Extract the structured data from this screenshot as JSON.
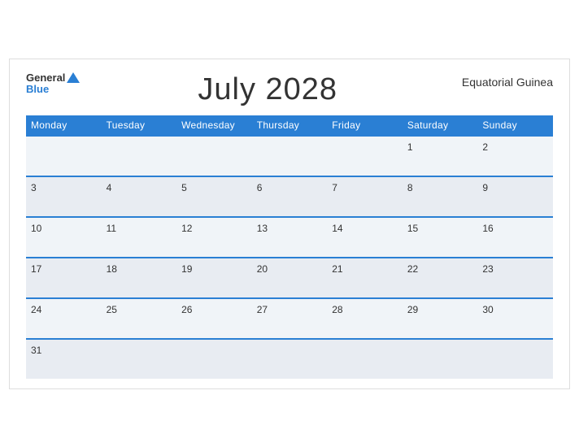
{
  "header": {
    "logo_general": "General",
    "logo_blue": "Blue",
    "month_title": "July 2028",
    "country": "Equatorial Guinea"
  },
  "days_of_week": [
    "Monday",
    "Tuesday",
    "Wednesday",
    "Thursday",
    "Friday",
    "Saturday",
    "Sunday"
  ],
  "weeks": [
    [
      null,
      null,
      null,
      null,
      null,
      1,
      2
    ],
    [
      3,
      4,
      5,
      6,
      7,
      8,
      9
    ],
    [
      10,
      11,
      12,
      13,
      14,
      15,
      16
    ],
    [
      17,
      18,
      19,
      20,
      21,
      22,
      23
    ],
    [
      24,
      25,
      26,
      27,
      28,
      29,
      30
    ],
    [
      31,
      null,
      null,
      null,
      null,
      null,
      null
    ]
  ]
}
